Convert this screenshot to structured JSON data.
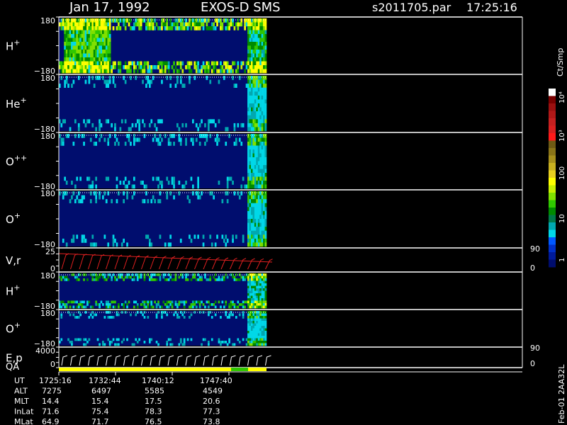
{
  "header": {
    "date": "Jan 17, 1992",
    "instrument": "EXOS-D SMS",
    "file": "s2011705.par",
    "time": "17:25:16"
  },
  "colorbar": {
    "unit": "Ct/Smp",
    "tick_labels": [
      "10⁴",
      "10³",
      "100",
      "10",
      "1"
    ],
    "colors": [
      "#ffffff",
      "#7a0000",
      "#9a1010",
      "#b01818",
      "#c42020",
      "#d82020",
      "#ff1a1a",
      "#6e5a14",
      "#8a7418",
      "#a8901c",
      "#c8b020",
      "#e8d020",
      "#ffff00",
      "#c8f000",
      "#80e000",
      "#30c800",
      "#008a00",
      "#007a4a",
      "#00a8b0",
      "#00d8e8",
      "#0058ff",
      "#0030c8",
      "#001a9a",
      "#000d6e"
    ]
  },
  "panels": [
    {
      "id": "h-plus-1",
      "label": "H",
      "sup": "+",
      "top_tick": "180",
      "bottom_tick": "−180"
    },
    {
      "id": "he-plus",
      "label": "He",
      "sup": "+",
      "top_tick": "180",
      "bottom_tick": "−180"
    },
    {
      "id": "o-plus-plus",
      "label": "O",
      "sup": "++",
      "top_tick": "180",
      "bottom_tick": "−180"
    },
    {
      "id": "o-plus-1",
      "label": "O",
      "sup": "+",
      "top_tick": "180",
      "bottom_tick": "−180"
    },
    {
      "id": "vr",
      "label": "V,r",
      "sup": "",
      "top_tick": "25",
      "bottom_tick": "0",
      "right_top": "90",
      "right_bottom": "0"
    },
    {
      "id": "h-plus-2",
      "label": "H",
      "sup": "+",
      "top_tick": "180",
      "bottom_tick": "−180"
    },
    {
      "id": "o-plus-2",
      "label": "O",
      "sup": "+",
      "top_tick": "180",
      "bottom_tick": "−180"
    },
    {
      "id": "ep",
      "label": "E,p",
      "sup": "",
      "top_tick": "4000",
      "bottom_tick": "0",
      "right_top": "90",
      "right_bottom": "0"
    }
  ],
  "qa_label": "QA",
  "footer": {
    "rows": [
      {
        "name": "UT",
        "values": [
          "1725:16",
          "1732:44",
          "1740:12",
          "1747:40"
        ]
      },
      {
        "name": "ALT",
        "values": [
          "7275",
          "6497",
          "5585",
          "4549"
        ]
      },
      {
        "name": "MLT",
        "values": [
          "14.4",
          "15.4",
          "17.5",
          "20.6"
        ]
      },
      {
        "name": "InLat",
        "values": [
          "71.6",
          "75.4",
          "78.3",
          "77.3"
        ]
      },
      {
        "name": "MLat",
        "values": [
          "64.9",
          "71.7",
          "76.5",
          "73.8"
        ]
      }
    ],
    "side_note": "Feb-01 2AA32L"
  },
  "chart_data": {
    "type": "heatmap",
    "title": "Jan 17, 1992   EXOS-D SMS",
    "x_ticks": [
      "1725:16",
      "1732:44",
      "1740:12",
      "1747:40"
    ],
    "data_coverage_fraction": 0.5,
    "panels": [
      {
        "name": "H+",
        "ylim": [
          -180,
          180
        ]
      },
      {
        "name": "He+",
        "ylim": [
          -180,
          180
        ]
      },
      {
        "name": "O++",
        "ylim": [
          -180,
          180
        ]
      },
      {
        "name": "O+",
        "ylim": [
          -180,
          180
        ]
      },
      {
        "name": "V,r",
        "ylim": [
          0,
          25
        ],
        "right_ylim": [
          0,
          90
        ]
      },
      {
        "name": "H+",
        "ylim": [
          -180,
          180
        ]
      },
      {
        "name": "O+",
        "ylim": [
          -180,
          180
        ]
      },
      {
        "name": "E,p",
        "ylim": [
          0,
          4000
        ],
        "right_ylim": [
          0,
          90
        ]
      }
    ],
    "colorbar": {
      "label": "Ct/Smp",
      "scale": "log",
      "ticks": [
        "1",
        "10",
        "100",
        "10³",
        "10⁴"
      ]
    }
  }
}
